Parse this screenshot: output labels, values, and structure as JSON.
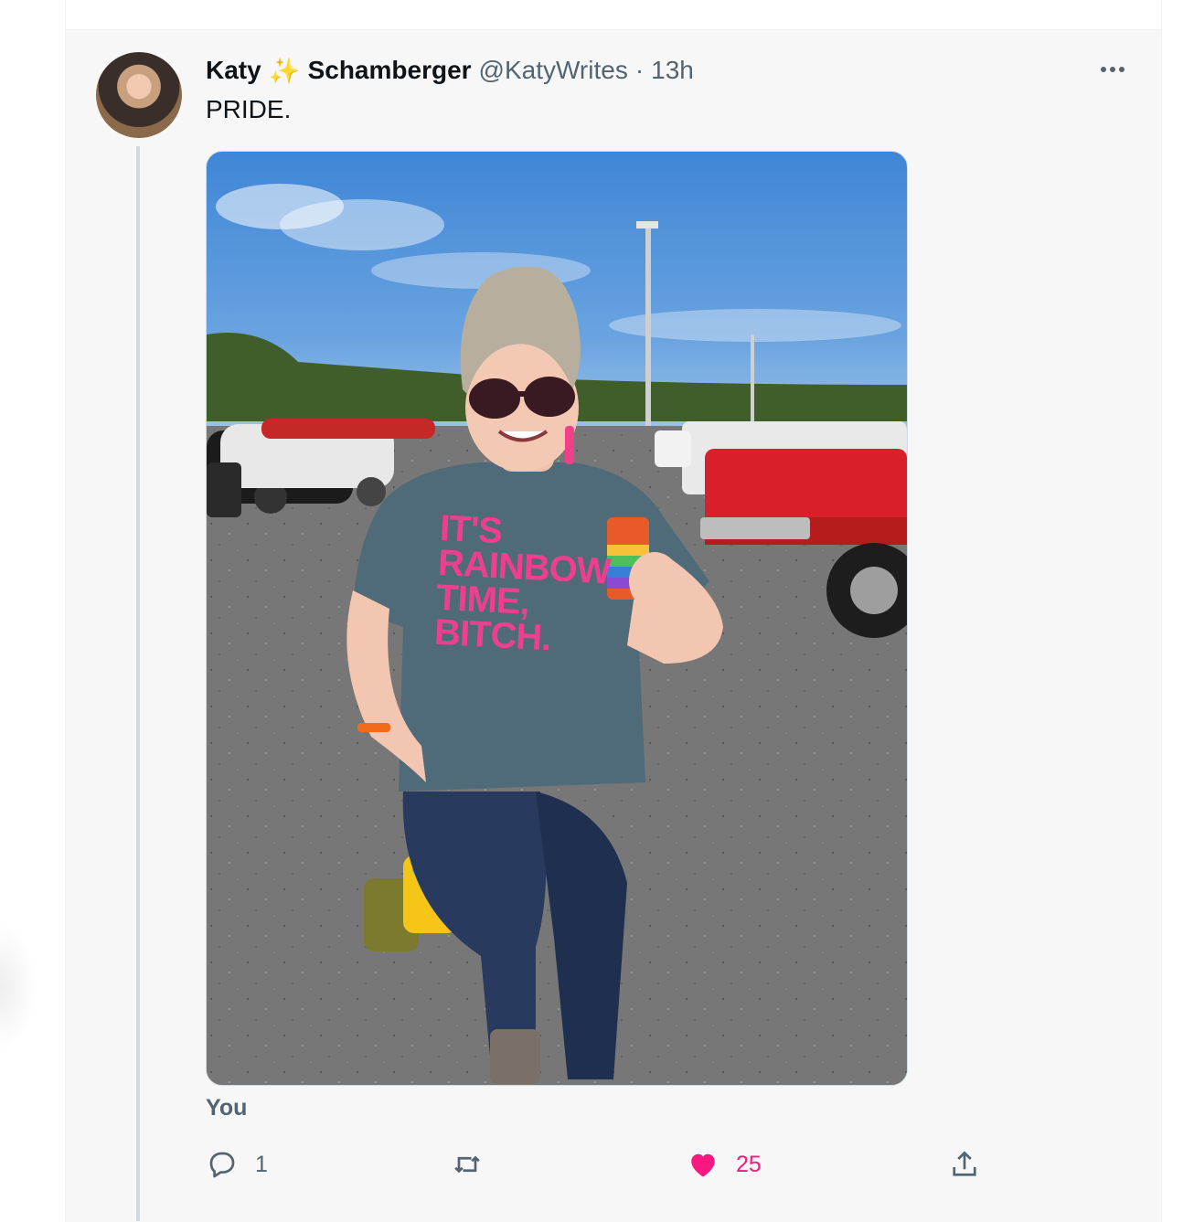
{
  "tweet": {
    "author": {
      "first_name": "Katy",
      "sparkle_emoji": "✨",
      "last_name": "Schamberger",
      "handle": "@KatyWrites",
      "separator": "·",
      "time": "13h"
    },
    "text": "PRIDE.",
    "media": {
      "shirt_text": [
        "IT'S",
        "RAINBOW",
        "TIME,",
        "BITCH."
      ]
    },
    "reply_context": "You",
    "actions": {
      "reply_count": "1",
      "retweet_count": "",
      "like_count": "25",
      "liked": true
    },
    "colors": {
      "like": "#f91880",
      "secondary_text": "#536471",
      "primary_text": "#0f1419"
    }
  }
}
